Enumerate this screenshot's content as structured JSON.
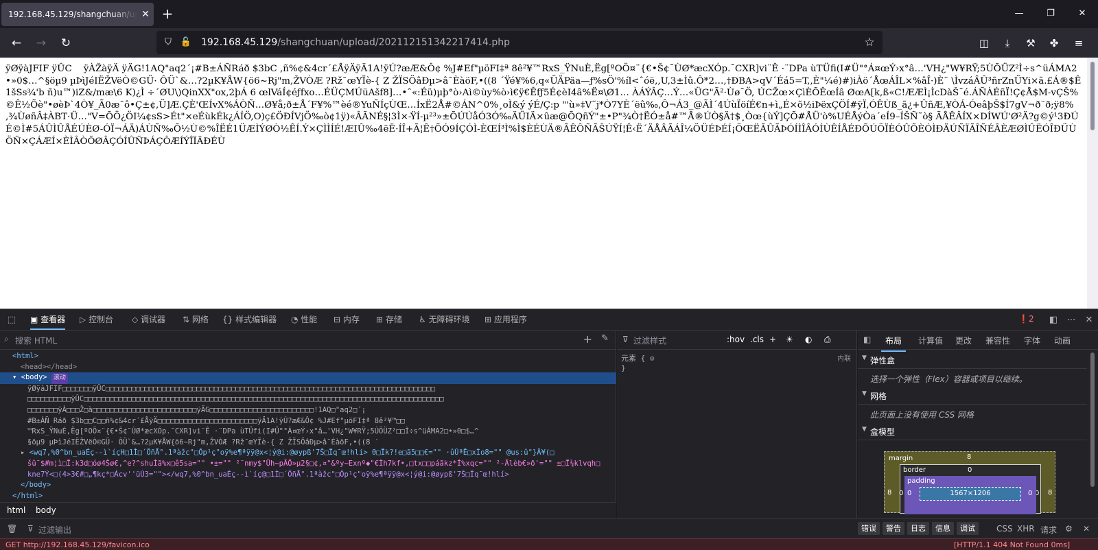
{
  "browser": {
    "tab_title": "192.168.45.129/shangchuan/uplo",
    "url_host": "192.168.45.129",
    "url_path": "/shangchuan/upload/202112151342217414.php"
  },
  "page": {
    "body_text": "ÿØÿàJFIF ÿÛC    ÿÀŽàÿÄ ÿÄG!1AQ\"aq2´¡#B±ÁÑRáð $3bC ,ñ%¢&4cr´£ÅÿÄÿÄ1A!ÿÚ?æÆ&Ô¢ %J#Ef\"µöFI‡ª 8ê²¥™RxS_ŸNuÈ,Ëg[ºOÖ¤¨{€•Š¢¯ÙØ*æcXÓp.¯CXR]vi¨Ê ·¨DPa ùTÜfi(I#Ü\"°Á¤œÝ›x°â…'VH¿\"W¥RŸ;5ÙÕÜZ²Ì÷s^üÁMA2•»0$…^§öµ9 µÞìJéIËŽVëÒ©GÜ· ÔÜ`&…?2µK¥ÅW{ö6~Rj\"m,ŽVÒÆ ?Rž¯œYÏè-{ Z ŽÏSÖâÐµ>â¯ÈàöF,•((8 ´Ÿé¥%6,q«ÜÄPäa—ƒ%sÖ'%íl<ˆóë,,U,3±Ìû.Ô*2…,†ÐBA>qV´Éá5=T,,È\"¼é)#)iÀö´ÅœÁÎL×%âÎ·)È¨ \\ÌvzáÂÛ³ñrZnÜYi×ã.£Á®$Ê1šSs¾'b ñ)u™)iZ&/mæ\\6 K)¿Ì ÷´ØU\\)QinXX\"ox,2þÁ 6 œlVáÍ¢éƒfxo…ÉÜÇMÚüAšf8]…•ˆ«:Éü)µþ°ò›Aì©ùy%ò›ì€ÿ€Êfƒ5É¢èI4â%Ë¤\\Ø1… ÀÁÝÂÇ…Ý…«ÜG\"Ã²·Ùø¯Ö, ÚCŽœ×ÇìÈÕÊœÍâ ØœA[k,ß«C!ÆÆÌ¡ÌcDàŠ¯é.ÁÑÀÉñÏ!Ç¢Å$M-vÇŠ%©Ê½Õè\"•øèÞ`4Ò¥_Ã0æ¯ô•Ç±¢,Ü]Æ.ÇÈ'ŒÍvX%ÁÒÑ…Ø¥å;ð±Å´F¥%™èé®YuÑÍçÙŒ…ÍxË2Å#©ÁN^0%¸oÌ&ý ýÉ/Ç:p \"'ù»‡V˜j*Ò7YÈ´ëû‰‚Ô¬Á3_@ÃÌ´4ÚùÏöíÉ€n+ì„É×õ½iÞëxÇÖÍ#ÿÏ,ÓÊÙß_ã¿+ÛñÆ,¥ÒÁ-ÓeâþŠ$Í7gV¬ð¨ð;ÿ8%‚¾ÙøñÂ‡ÀBT·Ü…\"V=ÕÖ¿ÖI¼¢sS>Ét\"×eÉùkÉk¿ÁÍÖ,O)ç£ÖÐÍVjÖ‰ò¢1ÿ)«ÂÃNÉ§¦3Ì×-ŸÍ-µ²³»±ÕÚÚåÓ3Ó‰ÄÜIÄ×ûæ@ÕQñÝ\"±•P\"¾Ò†ËÓ±å#™Å®ÚÒ§Ä†$¸Òœ{ùÝ]ÇÕ#ÅÜ'ò%UÉÅýÒa´eÍ9–ÍŠÑ˜ò§ ÃÅÊÂÍX×DÍWÚ'Ø²Ä?g©ý¹3ÐÚÉ©Ì#5ÁÛÌÛÅÉÚÈØ-ÓÏ¬ÁÄ)ÁÙÑ‰Õ½Ù©%ÎËÉ1ÜÆÌÝØÒ½ÊÍ.Ý×ÇÌÌÍÉ!ÆIÛ‰4ëË·ÍÎ+Ã¦Ê†ÕÓ9ÍÇÓÌ-ÈŒÍ³Ì%Ì$ÈÉÙÄ®ÃÊÔÑÃŠÚŸÍ¦Ê‹Ë´ÄÅÂÃÁÎ¼ÖÜÉÞÉÍ¡ÖŒËÃÛÃÞÓÍÌÎÂÓÍÙÊÍÅÉÐÕÚÖÏÈÓÛÕÈÓÌÐÄÚÑÏÃÎÑÉÂÈÆØÌÛËÓÎÐÜÙÖÑ×ÇÁÆÍ×ÈÌÂÒÕØÂÇÓÍÛÑÞÁÇÔÆÍÝÎÏÄÐÉÙ"
  },
  "devtools": {
    "tabs": [
      "查看器",
      "控制台",
      "调试器",
      "网络",
      "样式编辑器",
      "性能",
      "内存",
      "存储",
      "无障碍环境",
      "应用程序"
    ],
    "error_count": "2",
    "search_placeholder": "搜索 HTML",
    "tree": {
      "html_open": "<html>",
      "head": "<head></head>",
      "body_open": "<body>",
      "scroll_badge": "滚动",
      "text_lines": [
        "ÿØÿàJFIF□□□□□□□ÿÛC□□□□□□□□□□□□□□□□□□□□□□□□□□□□□□□□□□□□□□□□□□□□□□□□□□□□□□□□□□□□□□□□□□□□□□□□□□□□",
        "□□□□□□□□□□ÿÛC□□□□□□□□□□□□□□□□□□□□□□□□□□□□□□□□□□□□□□□□□□□□□□□□□□□□□□□□□□□□□□□□□□□□□□□□□□□□□□□□□□□",
        "□□□□□□□ÿÀ□□□Ž□à□□□□□□□□□□□□□□□□□□□□□□□□ÿÄG□□□□□□□□□□□□□□□□□□□□□□□□!1AQ□\"aq2□´¡",
        "#B±ÁÑ Ráð $3b□□C□□ñ%¢&4cr´£ÅÿÄ□□□□□□□□□□□□□□□□□□□□□□□ÿÄ1A!ÿÚ?æÆ&Ô¢ %J#Ef\"µöFI‡ª 8ê²¥™□□",
        "™RxS_ŸNuÈ,Ëg[ºOÖ¤¨{€•Š¢¯ÙØ*æcXÓp.¯CXR]vi¨Ê ·¨DPa ùTÜfi(I#Ü\"°Á¤œÝ›x°â…'VH¿\"W¥RŸ;5ÙÕÜZ²□□Ì÷s^üÁMA2□•»0□$…^",
        "§öµ9 µÞìJéIËŽVëÒ©GÜ· ÔÜ`&…?2µK¥ÅW{ö6~Rj\"m,ŽVÒÆ ?Rž¯œYÏè-{ Z ŽÏSÖâÐµ>â¯ÈàöF,•((8 ′"
      ],
      "child_line": "<wq7,%0^bn_uaÉç--ì`íçH□1Ì□´ÕñÅ°.1ªàžc\"□Ôp¹ç\"oÿ%e¶ªÿÿ@x<¦ý@i:@øypß'7Š□Ïq¯œ!hlí> 0□Ïk?!e□ã5□□€=\"\" ·ûÛªÊ□xÌo8=\"\" @us:û\"}Ã¥(□",
      "child_line2": "šû¯$#m¦ì□Ï:k3d□óø4Šø€,^e?^shuÌã%x□ê5sa=\"\" •±=\"\" ²¨nmy$\"Üh~pÃÖ»µ2§□¢,¤\"&ºy~Exnº◆\"€Ìh7kf•,□tx□□páãkz*Í%xqc=\"\" ²-Ãlèb€»ð'=\"\" ±□Ï¾klvqh□",
      "child_line3": "kne7Ý<□(4>3€#□„¶kç*□Ácv''üÙ3=\"\"></wq7,%0^bn_uaÉç--ì`íç@□1Ì□´ÕñÅ°.1ªàžc\"□Ôp¹ç\"oÿ%e¶ªÿÿ@x<¦ý@i:@øypß'7Š□Ïq¯œ!hlí>",
      "body_close": "</body>",
      "html_close": "</html>"
    },
    "breadcrumbs": [
      "html",
      "body"
    ],
    "rules": {
      "filter_placeholder": "过滤样式",
      "hov": ":hov",
      "cls": ".cls",
      "element_label": "元素 {",
      "element_close": "}",
      "inline": "内联"
    },
    "layout": {
      "tabs": [
        "布局",
        "计算值",
        "更改",
        "兼容性",
        "字体",
        "动画"
      ],
      "flex_title": "弹性盒",
      "flex_note": "选择一个弹性（Flex）容器或项目以继续。",
      "grid_title": "网格",
      "grid_note": "此页面上没有使用 CSS 网格",
      "boxmodel_title": "盒模型",
      "margin_label": "margin",
      "border_label": "border",
      "padding_label": "padding",
      "margin_value": "8",
      "border_value": "0",
      "padding_value": "0",
      "content_size": "1567×1206"
    },
    "console": {
      "filter_placeholder": "过滤输出",
      "levels": [
        "错误",
        "警告",
        "日志",
        "信息",
        "调试"
      ],
      "right_tabs": [
        "CSS",
        "XHR",
        "请求"
      ],
      "message": "GET http://192.168.45.129/favicon.ico",
      "status": "[HTTP/1.1 404 Not Found 0ms]"
    }
  }
}
